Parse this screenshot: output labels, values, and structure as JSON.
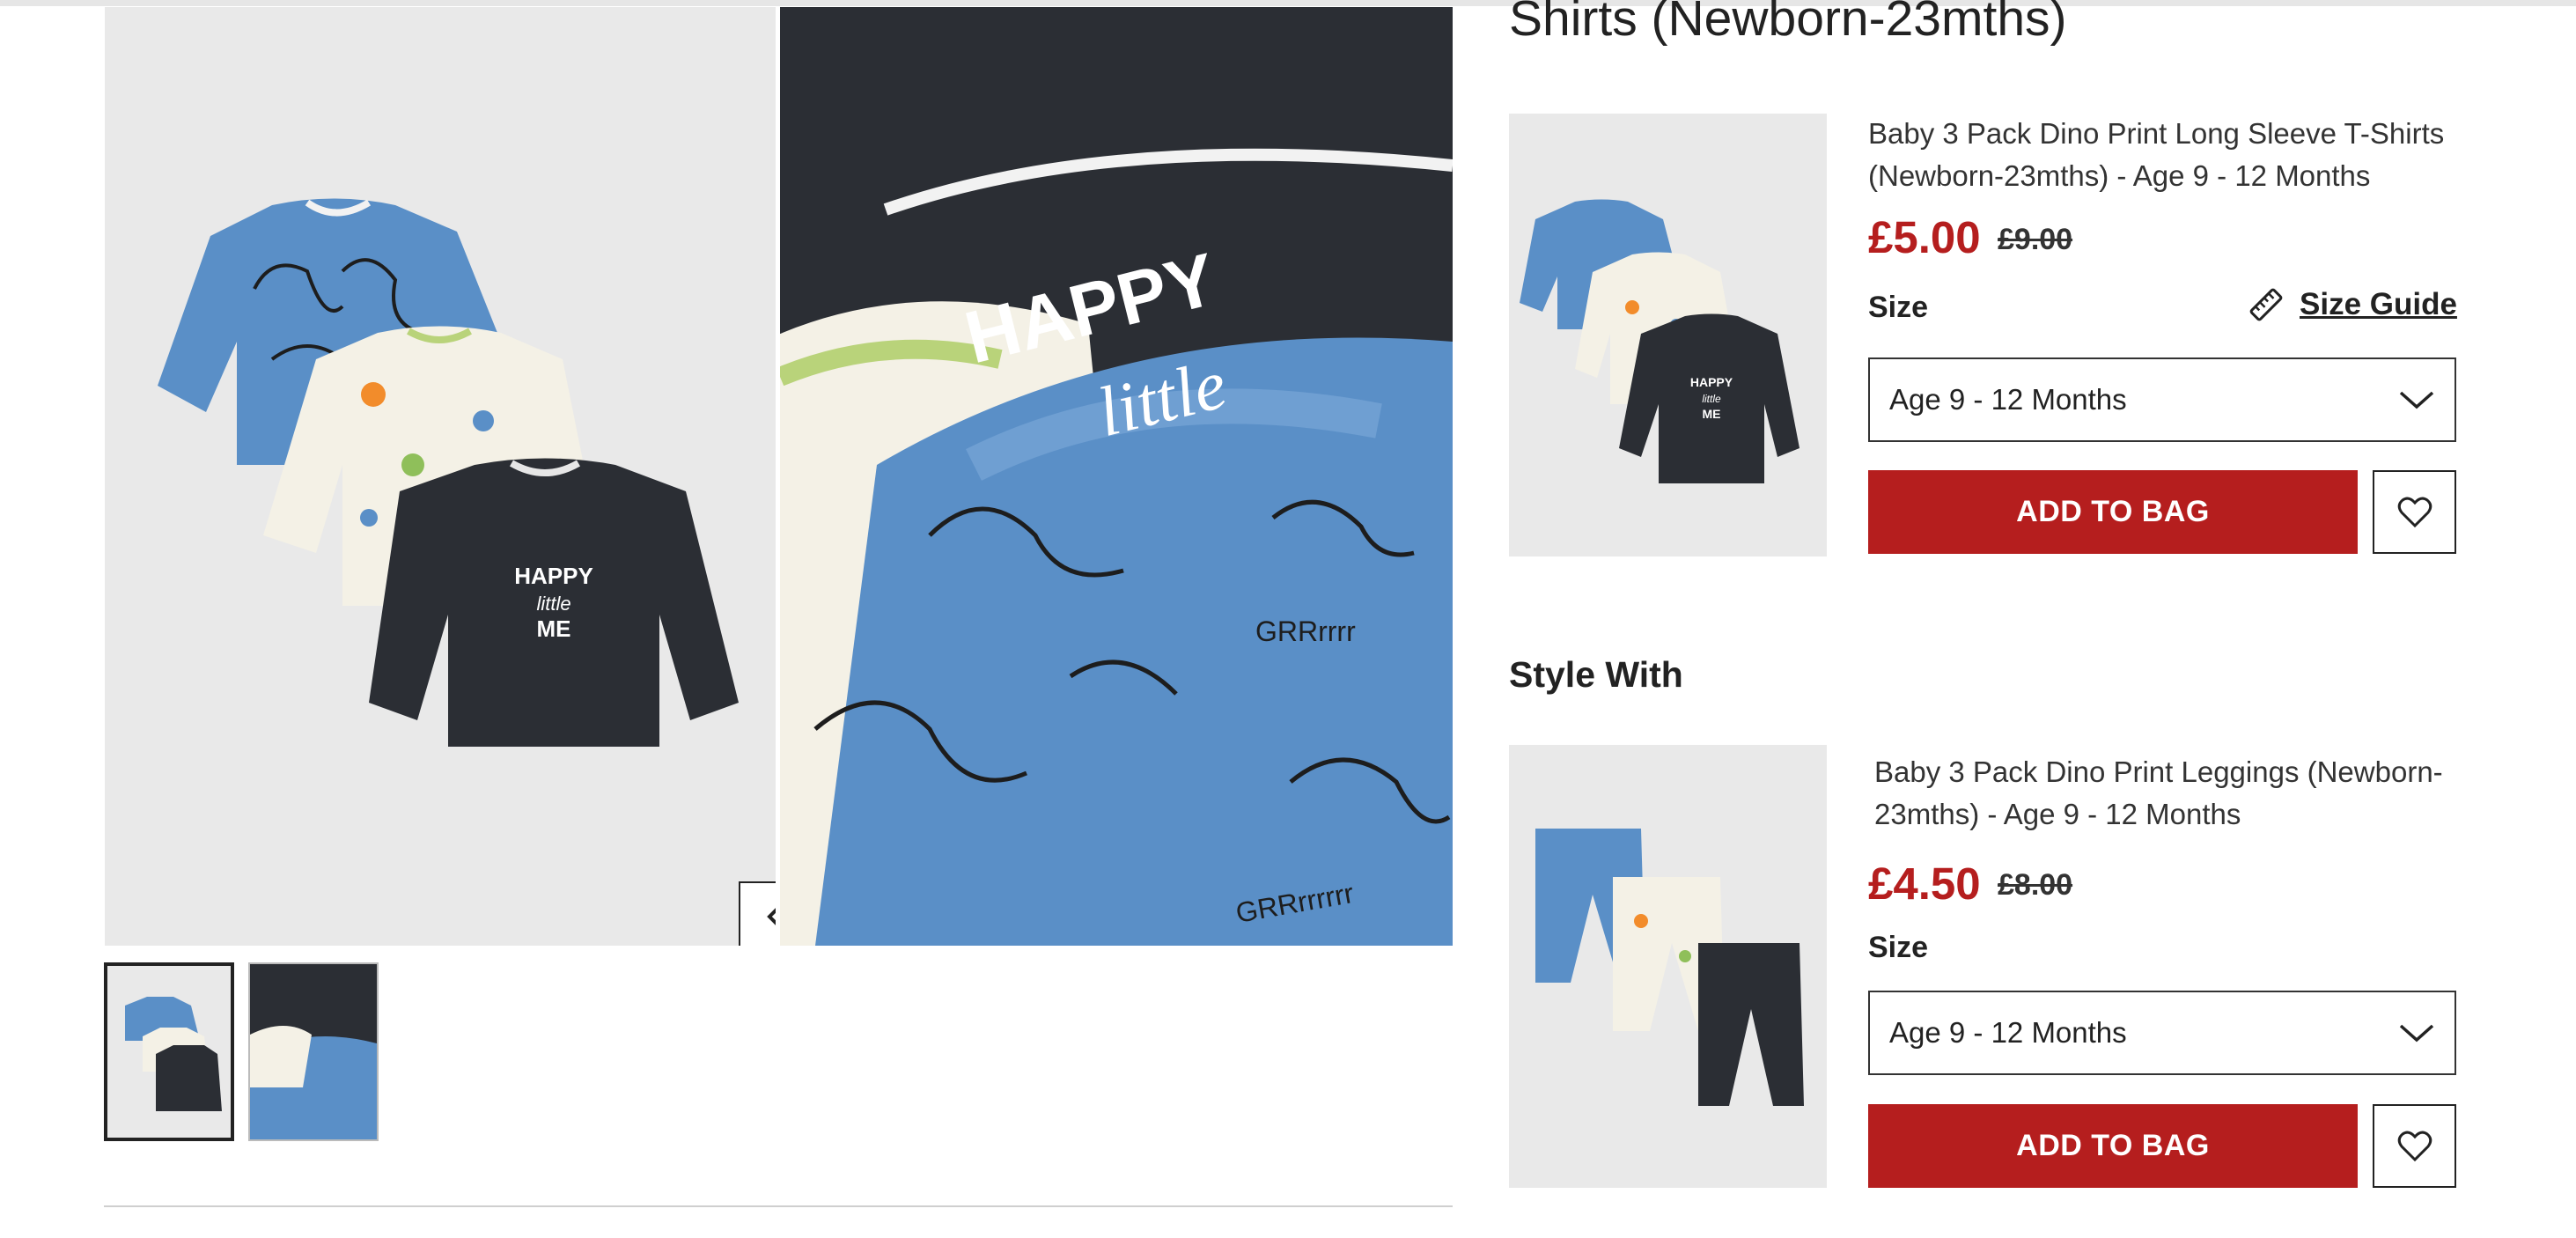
{
  "gallery": {
    "zoom_icon": "zoom-in-icon",
    "prev_icon": "chevron-left-icon",
    "next_icon": "chevron-right-icon",
    "image1_print": [
      "HAPPY",
      "little",
      "ME"
    ],
    "image2_print": [
      "HAPPY",
      "little"
    ],
    "image2_grr": [
      "GRRrrrr",
      "GRRrrrrrr"
    ]
  },
  "heading_partial": "Shirts (Newborn-23mths)",
  "products": [
    {
      "title": "Baby 3 Pack Dino Print Long Sleeve T-Shirts (Newborn-23mths) - Age 9 - 12 Months",
      "price": "£5.00",
      "was_price": "£9.00",
      "size_label": "Size",
      "size_value": "Age 9 - 12 Months",
      "add_label": "ADD TO BAG",
      "size_guide": "Size Guide"
    },
    {
      "title": "Baby 3 Pack Dino Print Leggings (Newborn-23mths) - Age 9 - 12 Months",
      "price": "£4.50",
      "was_price": "£8.00",
      "size_label": "Size",
      "size_value": "Age 9 - 12 Months",
      "add_label": "ADD TO BAG"
    }
  ],
  "style_with": "Style With",
  "colors": {
    "accent_red": "#b51e1e",
    "tee_blue": "#5a8fc7",
    "tee_cream": "#f4f1e6",
    "tee_navy": "#2b2e34"
  }
}
